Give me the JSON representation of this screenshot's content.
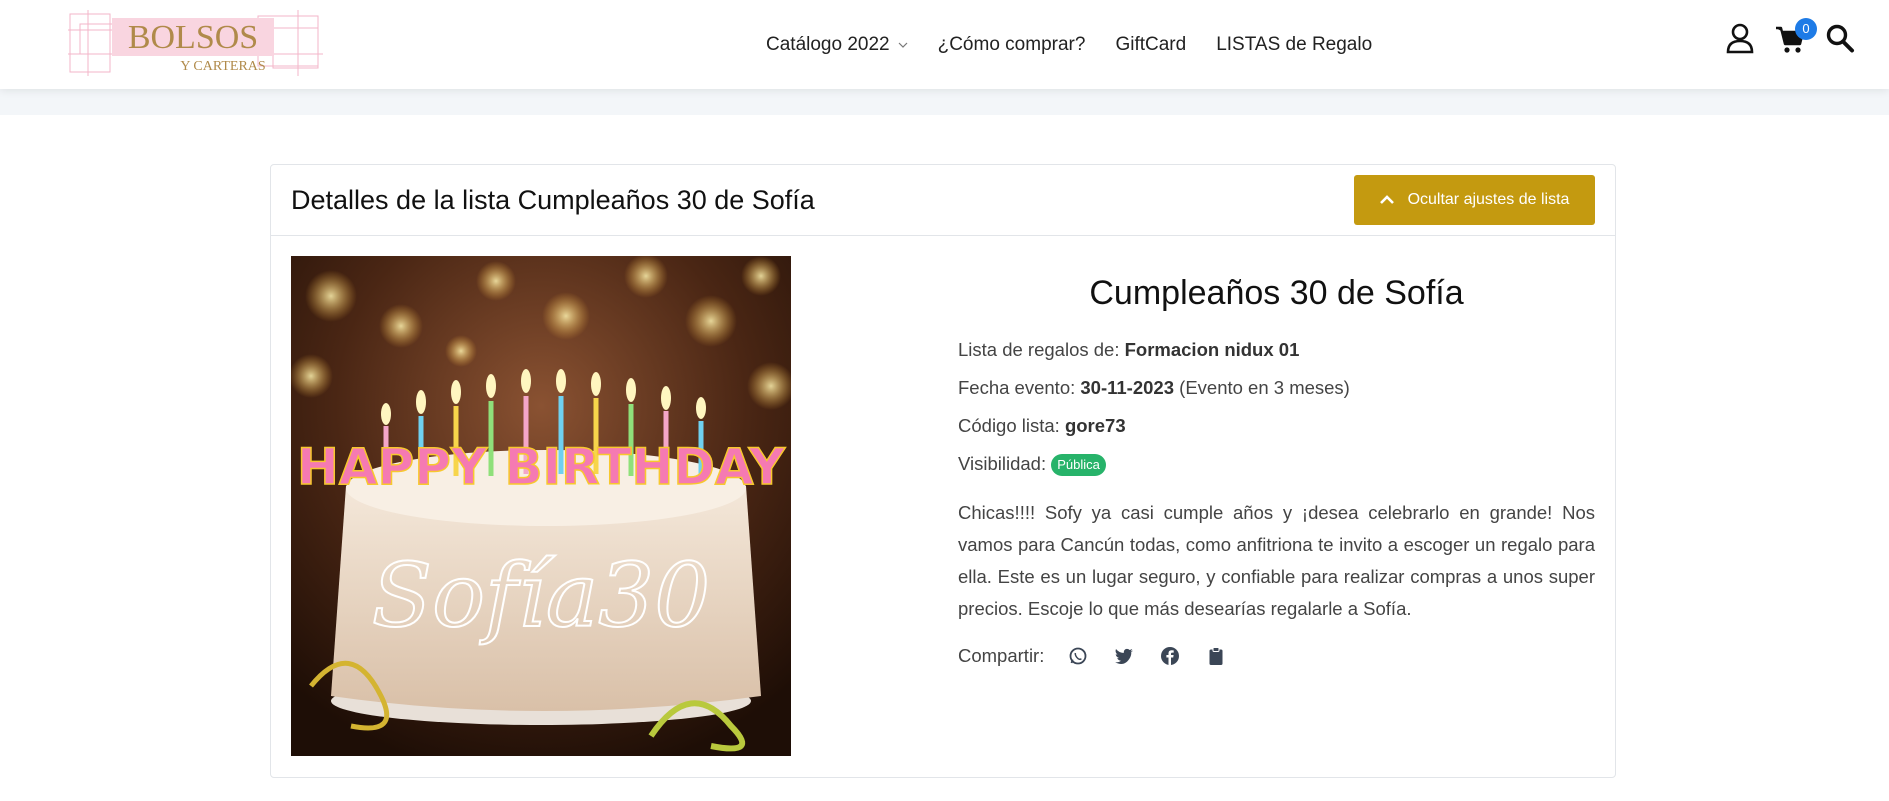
{
  "logo": {
    "line1": "BOLSOS",
    "line2": "Y CARTERAS"
  },
  "nav": {
    "items": [
      "Catálogo 2022",
      "¿Cómo comprar?",
      "GiftCard",
      "LISTAS de Regalo"
    ]
  },
  "cart": {
    "count": "0"
  },
  "icons": [
    "user-icon",
    "cart-icon",
    "search-icon",
    "whatsapp-icon",
    "twitter-icon",
    "facebook-icon",
    "clipboard-icon"
  ],
  "card": {
    "title": "Detalles de la lista Cumpleaños 30 de Sofía",
    "toggle_label": "Ocultar ajustes de lista"
  },
  "photo": {
    "banner": "HAPPY BIRTHDAY",
    "script": "Sofía30"
  },
  "details": {
    "heading": "Cumpleaños 30 de Sofía",
    "owner_label": "Lista de regalos de:",
    "owner_value": "Formacion nidux 01",
    "date_label": "Fecha evento:",
    "date_value": "30-11-2023",
    "date_note": "(Evento en 3 meses)",
    "code_label": "Código lista:",
    "code_value": "gore73",
    "visibility_label": "Visibilidad:",
    "visibility_value": "Pública",
    "description": "Chicas!!!! Sofy ya casi cumple años y ¡desea celebrarlo en grande! Nos vamos para Cancún todas, como anfitriona te invito a escoger un regalo para ella. Este es un lugar seguro, y confiable para realizar compras a unos super precios. Escoje lo que más desearías regalarle a Sofía.",
    "share_label": "Compartir:"
  },
  "colors": {
    "accent": "#c49a10",
    "badge": "#1e7be6",
    "public": "#27b36a"
  }
}
